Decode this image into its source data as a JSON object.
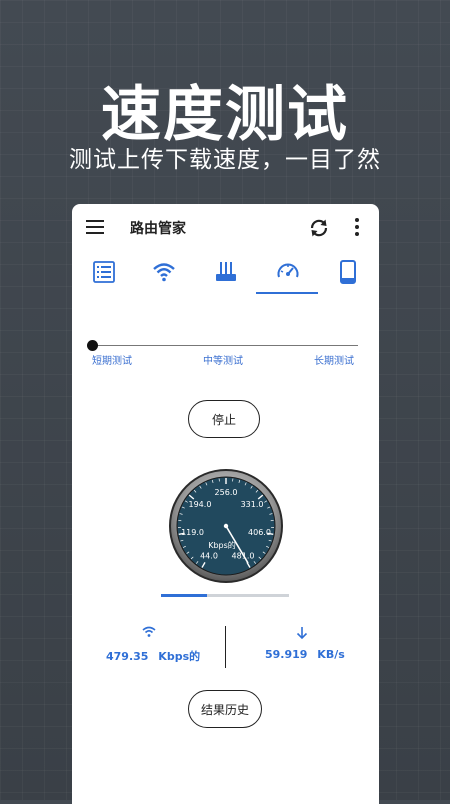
{
  "hero": {
    "title": "速度测试",
    "subtitle": "测试上传下载速度，一目了然"
  },
  "appbar": {
    "title": "路由管家",
    "icons": [
      "menu-icon",
      "refresh-icon",
      "more-vertical-icon"
    ]
  },
  "tabs": [
    {
      "icon": "list-icon"
    },
    {
      "icon": "wifi-icon"
    },
    {
      "icon": "router-icon"
    },
    {
      "icon": "speedometer-icon",
      "selected": true
    },
    {
      "icon": "phone-icon"
    }
  ],
  "test_slider": {
    "labels": [
      "短期测试",
      "中等测试",
      "长期测试"
    ],
    "selected": "短期测试"
  },
  "stop_button": "停止",
  "gauge": {
    "ticks": [
      "44.0",
      "119.0",
      "194.0",
      "256.0",
      "331.0",
      "406.0",
      "481.0"
    ],
    "unit": "Kbps的"
  },
  "progress": {
    "fraction": 0.36
  },
  "stats": {
    "download_value": "479.35",
    "download_unit": "Kbps的",
    "upload_value": "59.919",
    "upload_unit": "KB/s"
  },
  "history_button": "结果历史",
  "colors": {
    "accent": "#2f6fd6",
    "background": "#3d434a",
    "gauge_face": "#21495e"
  }
}
